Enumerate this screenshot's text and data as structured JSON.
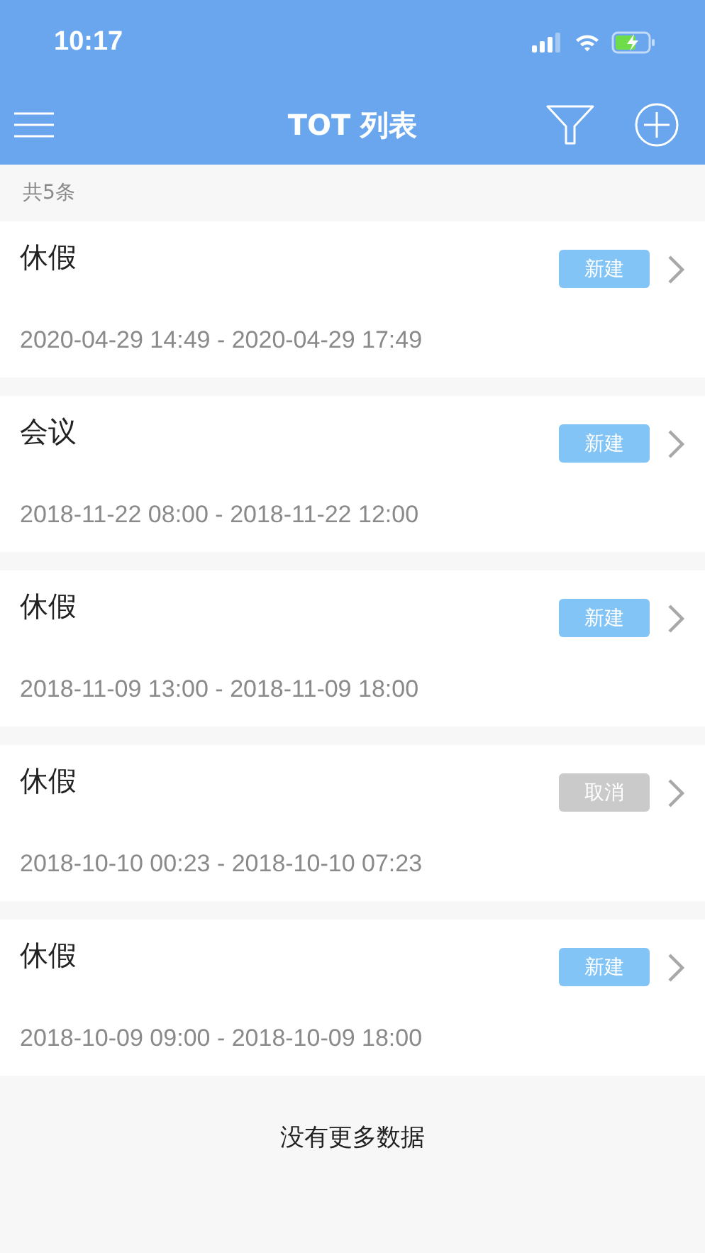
{
  "status_bar": {
    "time": "10:17"
  },
  "nav": {
    "title": "TOT 列表"
  },
  "count": "共5条",
  "items": [
    {
      "title": "休假",
      "badge": "新建",
      "kind": "new",
      "dates": "2020-04-29 14:49 - 2020-04-29 17:49"
    },
    {
      "title": "会议",
      "badge": "新建",
      "kind": "new",
      "dates": "2018-11-22 08:00 - 2018-11-22 12:00"
    },
    {
      "title": "休假",
      "badge": "新建",
      "kind": "new",
      "dates": "2018-11-09 13:00 - 2018-11-09 18:00"
    },
    {
      "title": "休假",
      "badge": "取消",
      "kind": "cancelled",
      "dates": "2018-10-10 00:23 - 2018-10-10 07:23"
    },
    {
      "title": "休假",
      "badge": "新建",
      "kind": "new",
      "dates": "2018-10-09 09:00 - 2018-10-09 18:00"
    }
  ],
  "footer": "没有更多数据"
}
